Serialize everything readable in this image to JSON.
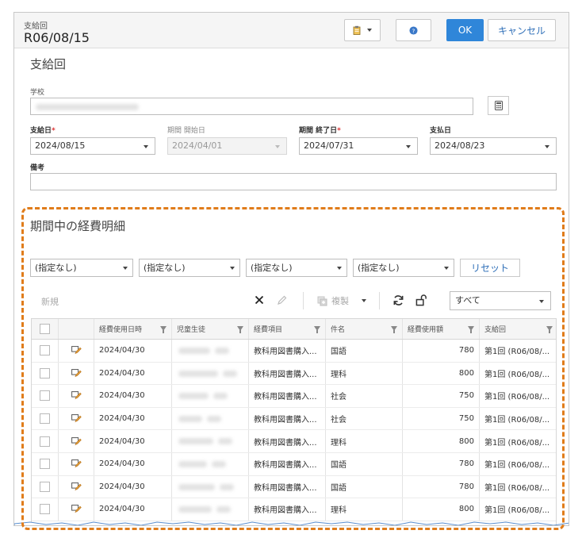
{
  "header": {
    "subtitle": "支給回",
    "title": "R06/08/15",
    "ok_label": "OK",
    "cancel_label": "キャンセル"
  },
  "form": {
    "section_title": "支給回",
    "school_label": "学校",
    "pay_date_label": "支給日",
    "period_start_label": "期間 開始日",
    "period_end_label": "期間 終了日",
    "payment_date_label": "支払日",
    "required_mark": "*",
    "pay_date_value": "2024/08/15",
    "period_start_value": "2024/04/01",
    "period_end_value": "2024/07/31",
    "payment_date_value": "2024/08/23",
    "notes_label": "備考"
  },
  "details": {
    "section_title": "期間中の経費明細",
    "filters": [
      "(指定なし)",
      "(指定なし)",
      "(指定なし)",
      "(指定なし)"
    ],
    "reset_label": "リセット",
    "new_label": "新規",
    "copy_label": "複製",
    "view_select_value": "すべて"
  },
  "grid": {
    "columns": [
      "経費使用日時",
      "児童生徒",
      "経費項目",
      "件名",
      "経費使用額",
      "支給回"
    ],
    "rows": [
      {
        "date": "2024/04/30",
        "item": "教科用図書購入...",
        "subject": "国語",
        "amount": "780",
        "round": "第1回 (R06/08/..."
      },
      {
        "date": "2024/04/30",
        "item": "教科用図書購入...",
        "subject": "理科",
        "amount": "800",
        "round": "第1回 (R06/08/..."
      },
      {
        "date": "2024/04/30",
        "item": "教科用図書購入...",
        "subject": "社会",
        "amount": "750",
        "round": "第1回 (R06/08/..."
      },
      {
        "date": "2024/04/30",
        "item": "教科用図書購入...",
        "subject": "社会",
        "amount": "750",
        "round": "第1回 (R06/08/..."
      },
      {
        "date": "2024/04/30",
        "item": "教科用図書購入...",
        "subject": "理科",
        "amount": "800",
        "round": "第1回 (R06/08/..."
      },
      {
        "date": "2024/04/30",
        "item": "教科用図書購入...",
        "subject": "国語",
        "amount": "780",
        "round": "第1回 (R06/08/..."
      },
      {
        "date": "2024/04/30",
        "item": "教科用図書購入...",
        "subject": "国語",
        "amount": "780",
        "round": "第1回 (R06/08/..."
      },
      {
        "date": "2024/04/30",
        "item": "教科用図書購入...",
        "subject": "理科",
        "amount": "800",
        "round": "第1回 (R06/08/..."
      }
    ]
  },
  "colors": {
    "accent": "#2f86d9",
    "highlight": "#e07c1a",
    "edit_icon": "#e8a33a"
  }
}
